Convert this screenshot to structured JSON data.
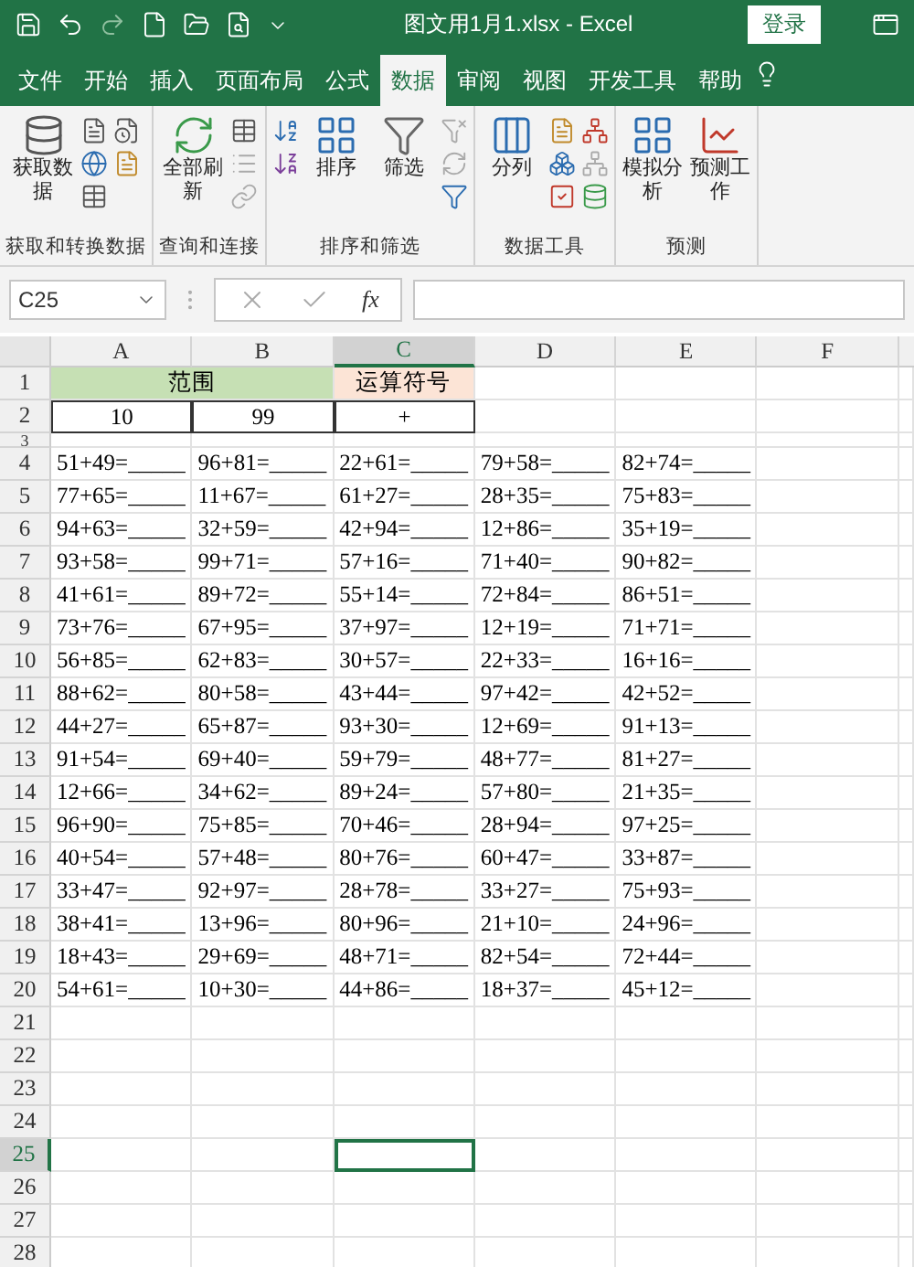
{
  "title_bar": {
    "title": "图文用1月1.xlsx  -  Excel",
    "login_button": "登录"
  },
  "tabs": [
    {
      "label": "文件",
      "selected": false
    },
    {
      "label": "开始",
      "selected": false
    },
    {
      "label": "插入",
      "selected": false
    },
    {
      "label": "页面布局",
      "selected": false
    },
    {
      "label": "公式",
      "selected": false
    },
    {
      "label": "数据",
      "selected": true
    },
    {
      "label": "审阅",
      "selected": false
    },
    {
      "label": "视图",
      "selected": false
    },
    {
      "label": "开发工具",
      "selected": false
    },
    {
      "label": "帮助",
      "selected": false
    }
  ],
  "ribbon_groups": [
    {
      "label": "获取和转换数据",
      "kind": "get",
      "buttons": [
        "获取数据"
      ]
    },
    {
      "label": "查询和连接",
      "kind": "refresh",
      "buttons": [
        "全部刷新"
      ]
    },
    {
      "label": "排序和筛选",
      "kind": "sort",
      "buttons": [
        "排序",
        "筛选"
      ]
    },
    {
      "label": "数据工具",
      "kind": "tools",
      "buttons": [
        "分列"
      ]
    },
    {
      "label": "预测",
      "kind": "forecast",
      "buttons": [
        "模拟分析",
        "预测工作"
      ]
    }
  ],
  "formula_bar": {
    "name_box": "C25",
    "function_label": "fx"
  },
  "columns": [
    {
      "label": "A",
      "selected": false
    },
    {
      "label": "B",
      "selected": false
    },
    {
      "label": "C",
      "selected": true
    },
    {
      "label": "D",
      "selected": false
    },
    {
      "label": "E",
      "selected": false
    },
    {
      "label": "F",
      "selected": false
    }
  ],
  "rows": [
    {
      "number": "1",
      "kind": "heading",
      "selected": false,
      "cells": [
        {
          "text": "范围",
          "merged": true,
          "color": "#c6e0b4"
        },
        {
          "text": "运算符号",
          "merged": false,
          "color": "#fce4d6"
        }
      ]
    },
    {
      "number": "2",
      "kind": "inputs",
      "selected": false,
      "cells": [
        "10",
        "99",
        "+"
      ]
    },
    {
      "number": "3",
      "kind": "gap",
      "selected": false
    },
    {
      "number": "4",
      "kind": "problems",
      "selected": false,
      "cells": [
        "51+49=_____",
        "96+81=_____",
        "22+61=_____",
        "79+58=_____",
        "82+74=_____"
      ]
    },
    {
      "number": "5",
      "kind": "problems",
      "selected": false,
      "cells": [
        "77+65=_____",
        "11+67=_____",
        "61+27=_____",
        "28+35=_____",
        "75+83=_____"
      ]
    },
    {
      "number": "6",
      "kind": "problems",
      "selected": false,
      "cells": [
        "94+63=_____",
        "32+59=_____",
        "42+94=_____",
        "12+86=_____",
        "35+19=_____"
      ]
    },
    {
      "number": "7",
      "kind": "problems",
      "selected": false,
      "cells": [
        "93+58=_____",
        "99+71=_____",
        "57+16=_____",
        "71+40=_____",
        "90+82=_____"
      ]
    },
    {
      "number": "8",
      "kind": "problems",
      "selected": false,
      "cells": [
        "41+61=_____",
        "89+72=_____",
        "55+14=_____",
        "72+84=_____",
        "86+51=_____"
      ]
    },
    {
      "number": "9",
      "kind": "problems",
      "selected": false,
      "cells": [
        "73+76=_____",
        "67+95=_____",
        "37+97=_____",
        "12+19=_____",
        "71+71=_____"
      ]
    },
    {
      "number": "10",
      "kind": "problems",
      "selected": false,
      "cells": [
        "56+85=_____",
        "62+83=_____",
        "30+57=_____",
        "22+33=_____",
        "16+16=_____"
      ]
    },
    {
      "number": "11",
      "kind": "problems",
      "selected": false,
      "cells": [
        "88+62=_____",
        "80+58=_____",
        "43+44=_____",
        "97+42=_____",
        "42+52=_____"
      ]
    },
    {
      "number": "12",
      "kind": "problems",
      "selected": false,
      "cells": [
        "44+27=_____",
        "65+87=_____",
        "93+30=_____",
        "12+69=_____",
        "91+13=_____"
      ]
    },
    {
      "number": "13",
      "kind": "problems",
      "selected": false,
      "cells": [
        "91+54=_____",
        "69+40=_____",
        "59+79=_____",
        "48+77=_____",
        "81+27=_____"
      ]
    },
    {
      "number": "14",
      "kind": "problems",
      "selected": false,
      "cells": [
        "12+66=_____",
        "34+62=_____",
        "89+24=_____",
        "57+80=_____",
        "21+35=_____"
      ]
    },
    {
      "number": "15",
      "kind": "problems",
      "selected": false,
      "cells": [
        "96+90=_____",
        "75+85=_____",
        "70+46=_____",
        "28+94=_____",
        "97+25=_____"
      ]
    },
    {
      "number": "16",
      "kind": "problems",
      "selected": false,
      "cells": [
        "40+54=_____",
        "57+48=_____",
        "80+76=_____",
        "60+47=_____",
        "33+87=_____"
      ]
    },
    {
      "number": "17",
      "kind": "problems",
      "selected": false,
      "cells": [
        "33+47=_____",
        "92+97=_____",
        "28+78=_____",
        "33+27=_____",
        "75+93=_____"
      ]
    },
    {
      "number": "18",
      "kind": "problems",
      "selected": false,
      "cells": [
        "38+41=_____",
        "13+96=_____",
        "80+96=_____",
        "21+10=_____",
        "24+96=_____"
      ]
    },
    {
      "number": "19",
      "kind": "problems",
      "selected": false,
      "cells": [
        "18+43=_____",
        "29+69=_____",
        "48+71=_____",
        "82+54=_____",
        "72+44=_____"
      ]
    },
    {
      "number": "20",
      "kind": "problems",
      "selected": false,
      "cells": [
        "54+61=_____",
        "10+30=_____",
        "44+86=_____",
        "18+37=_____",
        "45+12=_____"
      ]
    },
    {
      "number": "21",
      "kind": "empty",
      "selected": false
    },
    {
      "number": "22",
      "kind": "empty",
      "selected": false
    },
    {
      "number": "23",
      "kind": "empty",
      "selected": false
    },
    {
      "number": "24",
      "kind": "empty",
      "selected": false
    },
    {
      "number": "25",
      "kind": "empty",
      "selected": true
    },
    {
      "number": "26",
      "kind": "empty",
      "selected": false
    },
    {
      "number": "27",
      "kind": "empty",
      "selected": false
    },
    {
      "number": "28",
      "kind": "empty",
      "selected": false
    }
  ]
}
